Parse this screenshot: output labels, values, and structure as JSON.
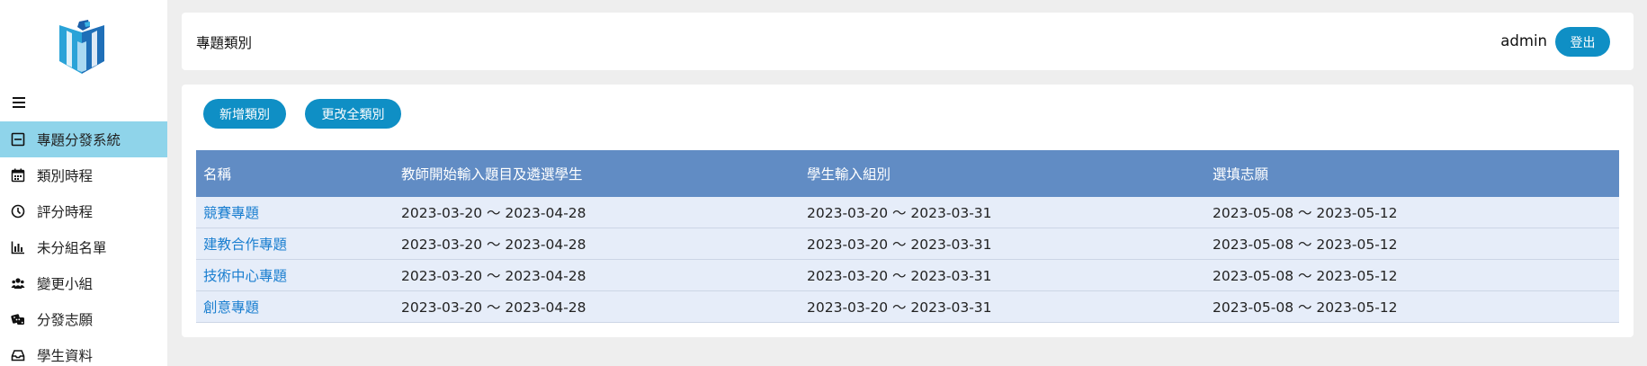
{
  "sidebar": {
    "menu_icon": "hamburger-icon",
    "items": [
      {
        "label": "專題分發系統",
        "icon": "minus-square-icon",
        "active": true
      },
      {
        "label": "類別時程",
        "icon": "calendar-icon",
        "active": false
      },
      {
        "label": "評分時程",
        "icon": "clock-icon",
        "active": false
      },
      {
        "label": "未分組名單",
        "icon": "bar-chart-icon",
        "active": false
      },
      {
        "label": "變更小組",
        "icon": "users-icon",
        "active": false
      },
      {
        "label": "分發志願",
        "icon": "dice-icon",
        "active": false
      },
      {
        "label": "學生資料",
        "icon": "inbox-icon",
        "active": false
      }
    ]
  },
  "header": {
    "title": "專題類別",
    "user": "admin",
    "logout_label": "登出"
  },
  "toolbar": {
    "add_label": "新增類別",
    "change_all_label": "更改全類別"
  },
  "table": {
    "headers": [
      "名稱",
      "教師開始輸入題目及遴選學生",
      "學生輸入組別",
      "選填志願"
    ],
    "rows": [
      [
        "競賽專題",
        "2023-03-20 〜 2023-04-28",
        "2023-03-20 〜 2023-03-31",
        "2023-05-08 〜 2023-05-12"
      ],
      [
        "建教合作專題",
        "2023-03-20 〜 2023-04-28",
        "2023-03-20 〜 2023-03-31",
        "2023-05-08 〜 2023-05-12"
      ],
      [
        "技術中心專題",
        "2023-03-20 〜 2023-04-28",
        "2023-03-20 〜 2023-03-31",
        "2023-05-08 〜 2023-05-12"
      ],
      [
        "創意專題",
        "2023-03-20 〜 2023-04-28",
        "2023-03-20 〜 2023-03-31",
        "2023-05-08 〜 2023-05-12"
      ]
    ]
  },
  "colors": {
    "accent": "#0f8fc5",
    "active_nav": "#8fd4ea",
    "table_header": "#618cc4",
    "table_row": "#e6edf9",
    "link": "#1b7fd0"
  }
}
